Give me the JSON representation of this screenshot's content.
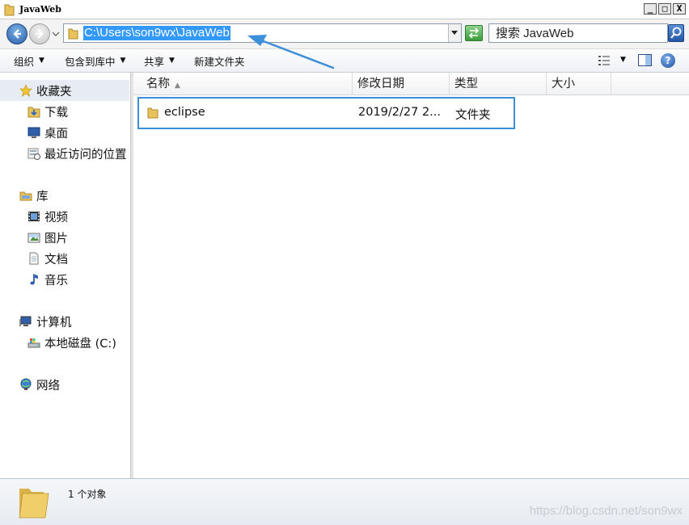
{
  "window": {
    "title": "JavaWeb",
    "minimize_label": "_",
    "maximize_label": "□",
    "close_label": "X"
  },
  "address": {
    "path": "C:\\Users\\son9wx\\JavaWeb"
  },
  "search": {
    "placeholder": "搜索 JavaWeb"
  },
  "toolbar": {
    "organize": "组织",
    "include_in_library": "包含到库中",
    "share": "共享",
    "new_folder": "新建文件夹",
    "help_label": "?"
  },
  "sidebar": {
    "favorites": {
      "label": "收藏夹",
      "items": [
        {
          "label": "下载",
          "icon": "download-folder-icon"
        },
        {
          "label": "桌面",
          "icon": "desktop-icon"
        },
        {
          "label": "最近访问的位置",
          "icon": "recent-places-icon"
        }
      ]
    },
    "libraries": {
      "label": "库",
      "items": [
        {
          "label": "视频",
          "icon": "video-icon"
        },
        {
          "label": "图片",
          "icon": "pictures-icon"
        },
        {
          "label": "文档",
          "icon": "documents-icon"
        },
        {
          "label": "音乐",
          "icon": "music-icon"
        }
      ]
    },
    "computer": {
      "label": "计算机",
      "items": [
        {
          "label": "本地磁盘 (C:)",
          "icon": "drive-icon"
        }
      ]
    },
    "network": {
      "label": "网络"
    }
  },
  "columns": {
    "name": "名称",
    "modified": "修改日期",
    "type": "类型",
    "size": "大小"
  },
  "files": [
    {
      "name": "eclipse",
      "modified": "2019/2/27 2...",
      "type": "文件夹",
      "size": ""
    }
  ],
  "status": {
    "count_text": "1 个对象"
  },
  "watermark": "https://blog.csdn.net/son9wx",
  "colors": {
    "selection": "#3399ff",
    "highlight_box": "#3b8ed8",
    "annotation_arrow": "#3d8fd9",
    "folder": "#e8c25a"
  }
}
